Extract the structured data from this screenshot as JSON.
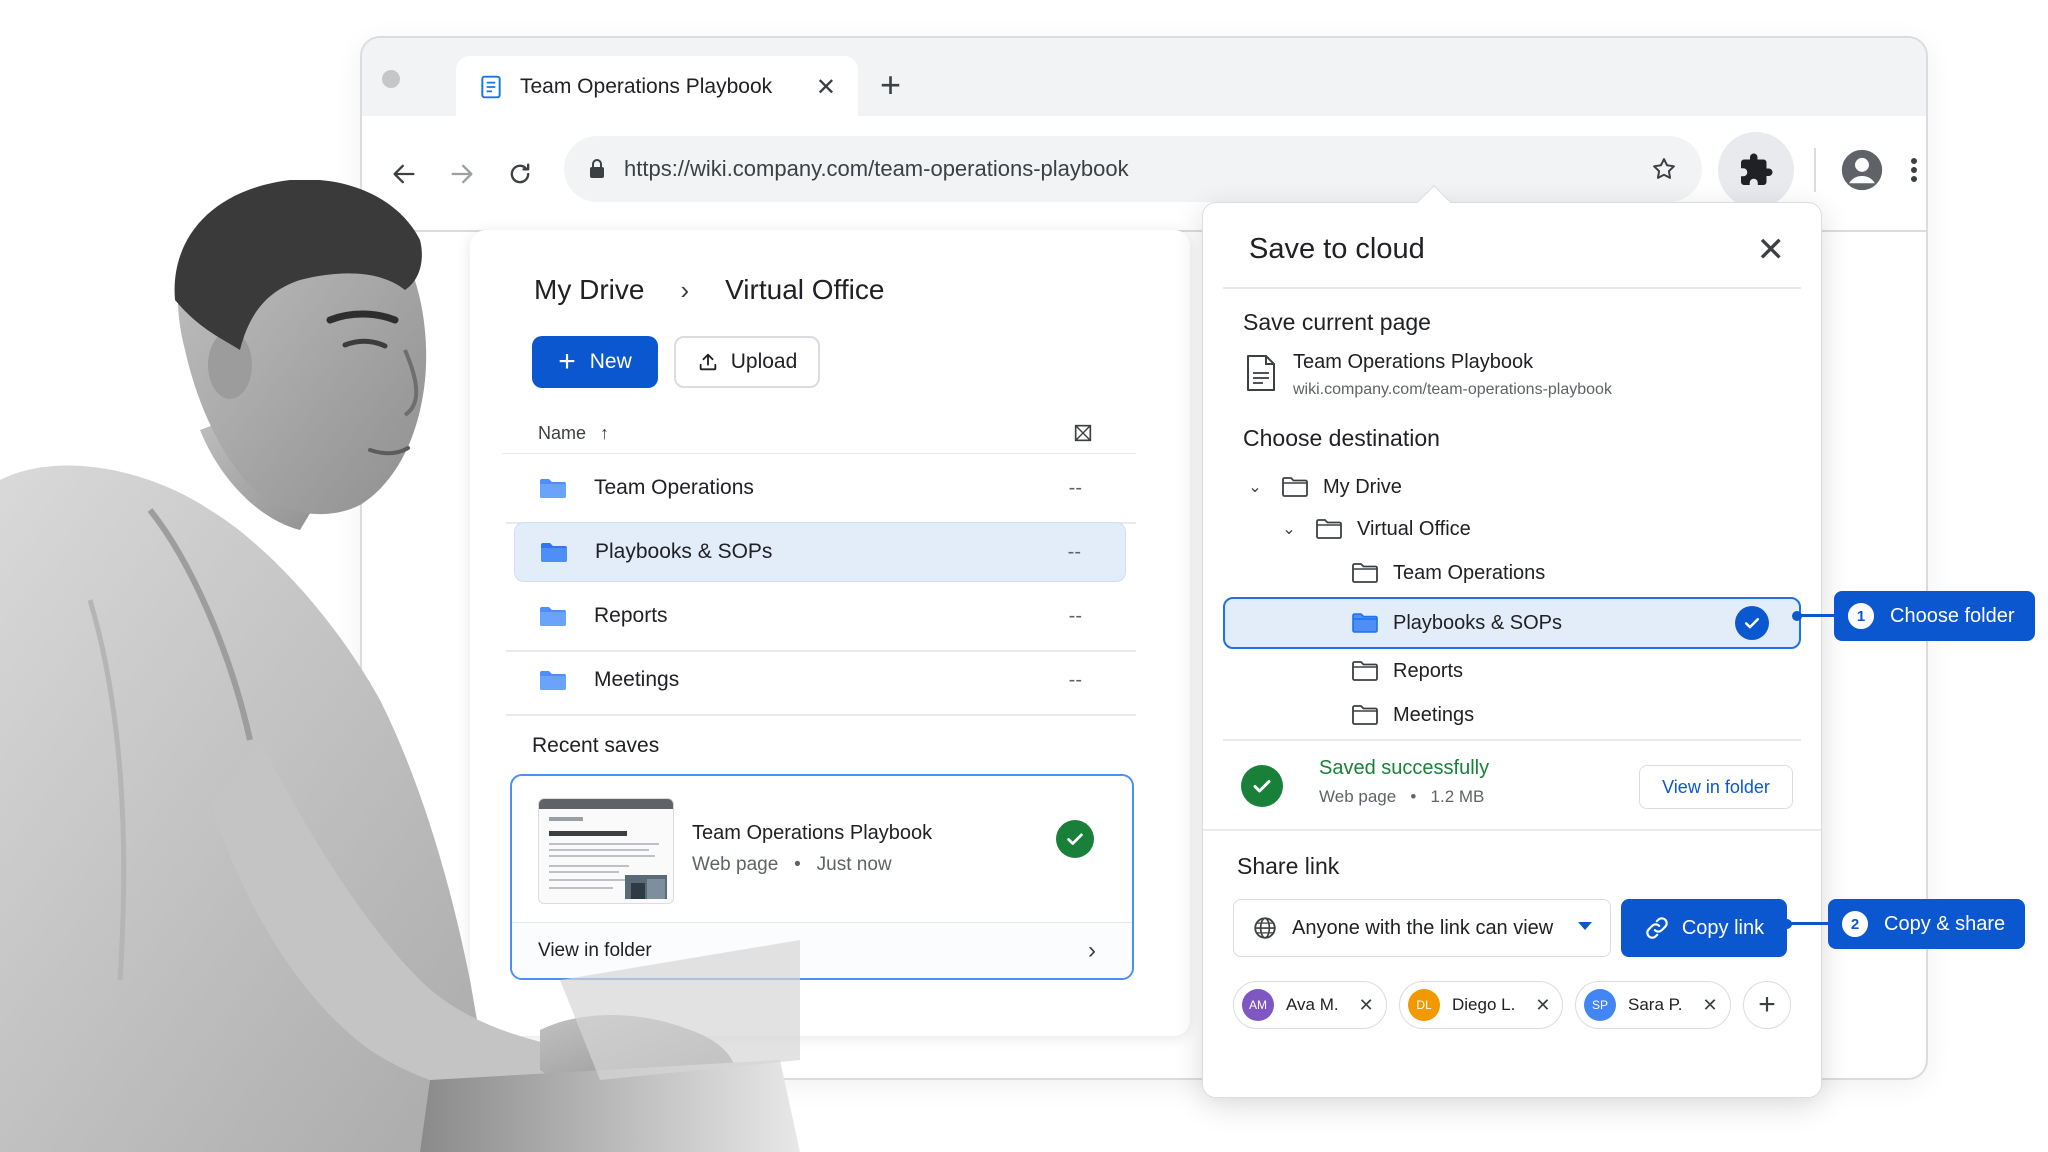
{
  "browser": {
    "tab_title": "Team Operations Playbook",
    "url": "https://wiki.company.com/team-operations-playbook"
  },
  "drive": {
    "breadcrumb": [
      "My Drive",
      "Virtual Office"
    ],
    "new_label": "New",
    "upload_label": "Upload",
    "column_name": "Name",
    "folders": [
      {
        "name": "Team Operations",
        "value": "--",
        "selected": false
      },
      {
        "name": "Playbooks & SOPs",
        "value": "--",
        "selected": true
      },
      {
        "name": "Reports",
        "value": "--",
        "selected": false
      },
      {
        "name": "Meetings",
        "value": "--",
        "selected": false
      }
    ],
    "recent_title": "Recent saves",
    "recent": {
      "title": "Team Operations Playbook",
      "type": "Web page",
      "time": "Just now",
      "action": "View in folder"
    }
  },
  "popup": {
    "title": "Save to cloud",
    "save_current_label": "Save current page",
    "page_title": "Team Operations Playbook",
    "page_url": "wiki.company.com/team-operations-playbook",
    "destination_label": "Choose destination",
    "tree": [
      {
        "name": "My Drive",
        "level": 0,
        "expanded": true
      },
      {
        "name": "Virtual Office",
        "level": 1,
        "expanded": true
      },
      {
        "name": "Team Operations",
        "level": 2
      },
      {
        "name": "Playbooks & SOPs",
        "level": 2,
        "selected": true
      },
      {
        "name": "Reports",
        "level": 2
      },
      {
        "name": "Meetings",
        "level": 2
      }
    ],
    "status_title": "Saved successfully",
    "status_type": "Web page",
    "status_size": "1.2 MB",
    "view_in_folder": "View in folder",
    "share_title": "Share link",
    "access_label": "Anyone with the link can view",
    "copy_label": "Copy link",
    "people": [
      {
        "initials": "AM",
        "name": "Ava M.",
        "color": "#7e57c2"
      },
      {
        "initials": "DL",
        "name": "Diego L.",
        "color": "#f29900"
      },
      {
        "initials": "SP",
        "name": "Sara P.",
        "color": "#4285f4"
      }
    ]
  },
  "callouts": [
    {
      "num": "1",
      "label": "Choose folder"
    },
    {
      "num": "2",
      "label": "Copy & share"
    }
  ],
  "colors": {
    "accent": "#0b57d0",
    "success": "#188038",
    "selected_bg": "#e3edfa"
  }
}
